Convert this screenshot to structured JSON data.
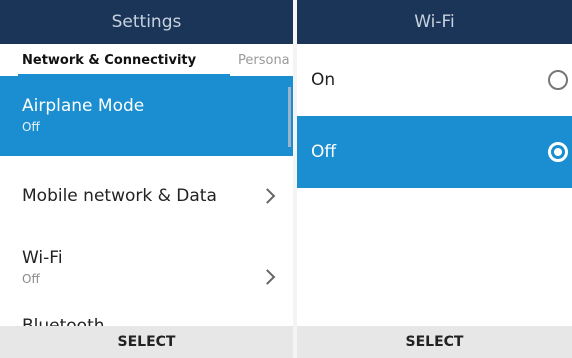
{
  "left": {
    "header": {
      "title": "Settings"
    },
    "tabs": {
      "active": "Network & Connectivity",
      "next": "Persona"
    },
    "items": [
      {
        "title": "Airplane Mode",
        "subtitle": "Off"
      },
      {
        "title": "Mobile network & Data"
      },
      {
        "title": "Wi-Fi",
        "subtitle": "Off"
      },
      {
        "title": "Bluetooth"
      }
    ],
    "footer": {
      "softkey_center": "SELECT"
    }
  },
  "right": {
    "header": {
      "title": "Wi-Fi"
    },
    "options": [
      {
        "label": "On",
        "checked": false
      },
      {
        "label": "Off",
        "checked": true
      }
    ],
    "footer": {
      "softkey_center": "SELECT"
    }
  },
  "colors": {
    "header_bg": "#1a3557",
    "accent": "#1a8ed1",
    "footer_bg": "#e7e7e7"
  },
  "icons": [
    "chevron-right-icon",
    "radio-unchecked-icon",
    "radio-checked-icon"
  ]
}
